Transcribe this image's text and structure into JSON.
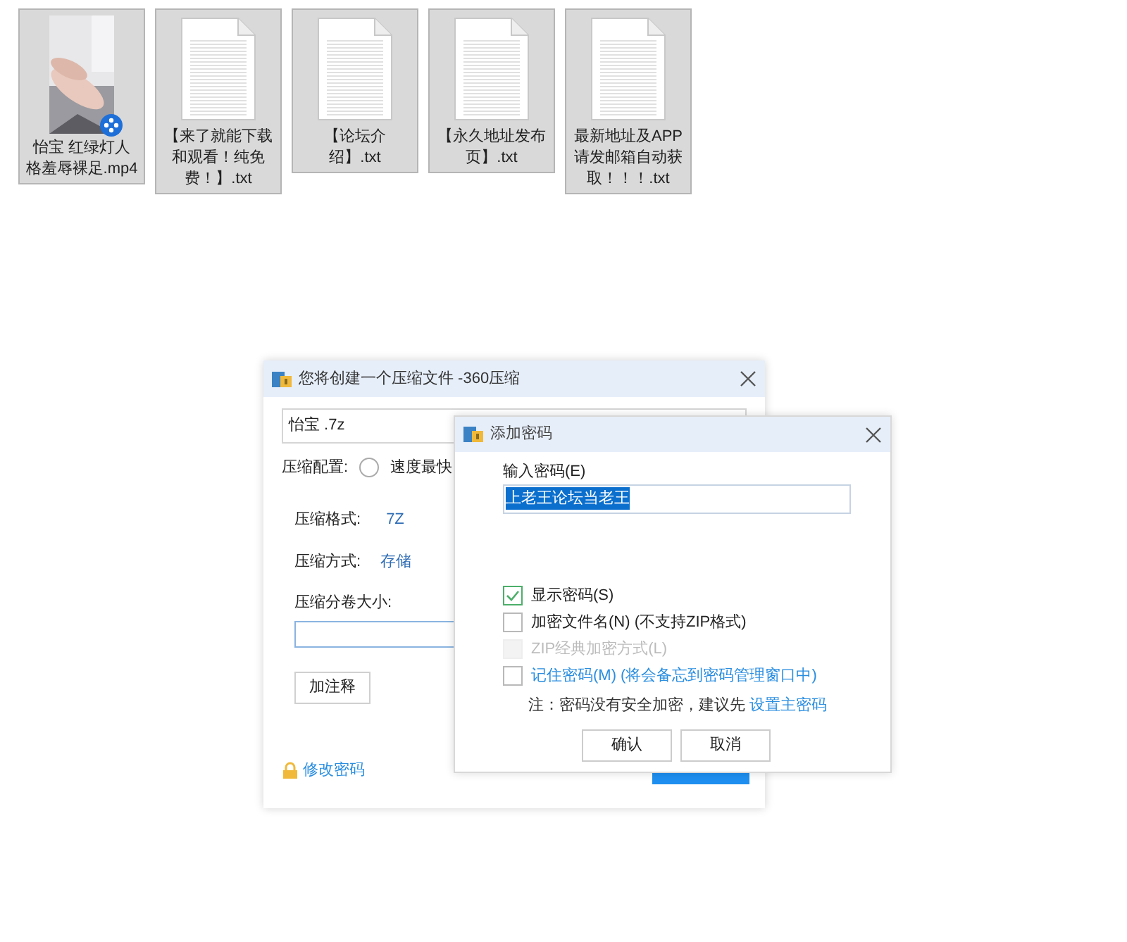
{
  "files": [
    {
      "name": "怡宝 红绿灯人格羞辱裸足.mp4",
      "kind": "video"
    },
    {
      "name": "【来了就能下载和观看！纯免费！】.txt",
      "kind": "text"
    },
    {
      "name": "【论坛介绍】.txt",
      "kind": "text"
    },
    {
      "name": "【永久地址发布页】.txt",
      "kind": "text"
    },
    {
      "name": "最新地址及APP请发邮箱自动获取！！！.txt",
      "kind": "text"
    }
  ],
  "main_dialog": {
    "title": "您将创建一个压缩文件 -360压缩",
    "filename": "怡宝 .7z",
    "config_label": "压缩配置:",
    "config_option": {
      "label": "速度最快",
      "selected": false
    },
    "format_label": "压缩格式:",
    "format_value": "7Z",
    "method_label": "压缩方式:",
    "method_value": "存储",
    "volume_label": "压缩分卷大小:",
    "comment_button": "加注释",
    "change_password_link": "修改密码"
  },
  "password_dialog": {
    "title": "添加密码",
    "password_label": "输入密码(E)",
    "password_value": "上老王论坛当老王",
    "options": [
      {
        "label": "显示密码(S)",
        "checked": true,
        "disabled": false,
        "kind": "plain"
      },
      {
        "label": "加密文件名(N) (不支持ZIP格式)",
        "checked": false,
        "disabled": false,
        "kind": "plain"
      },
      {
        "label": "ZIP经典加密方式(L)",
        "checked": false,
        "disabled": true,
        "kind": "plain"
      },
      {
        "label": "记住密码(M) (将会备忘到密码管理窗口中)",
        "checked": false,
        "disabled": false,
        "kind": "link"
      }
    ],
    "note": "注：密码没有安全加密，建议先",
    "note_link": "设置主密码",
    "buttons": [
      "确认",
      "取消"
    ]
  }
}
